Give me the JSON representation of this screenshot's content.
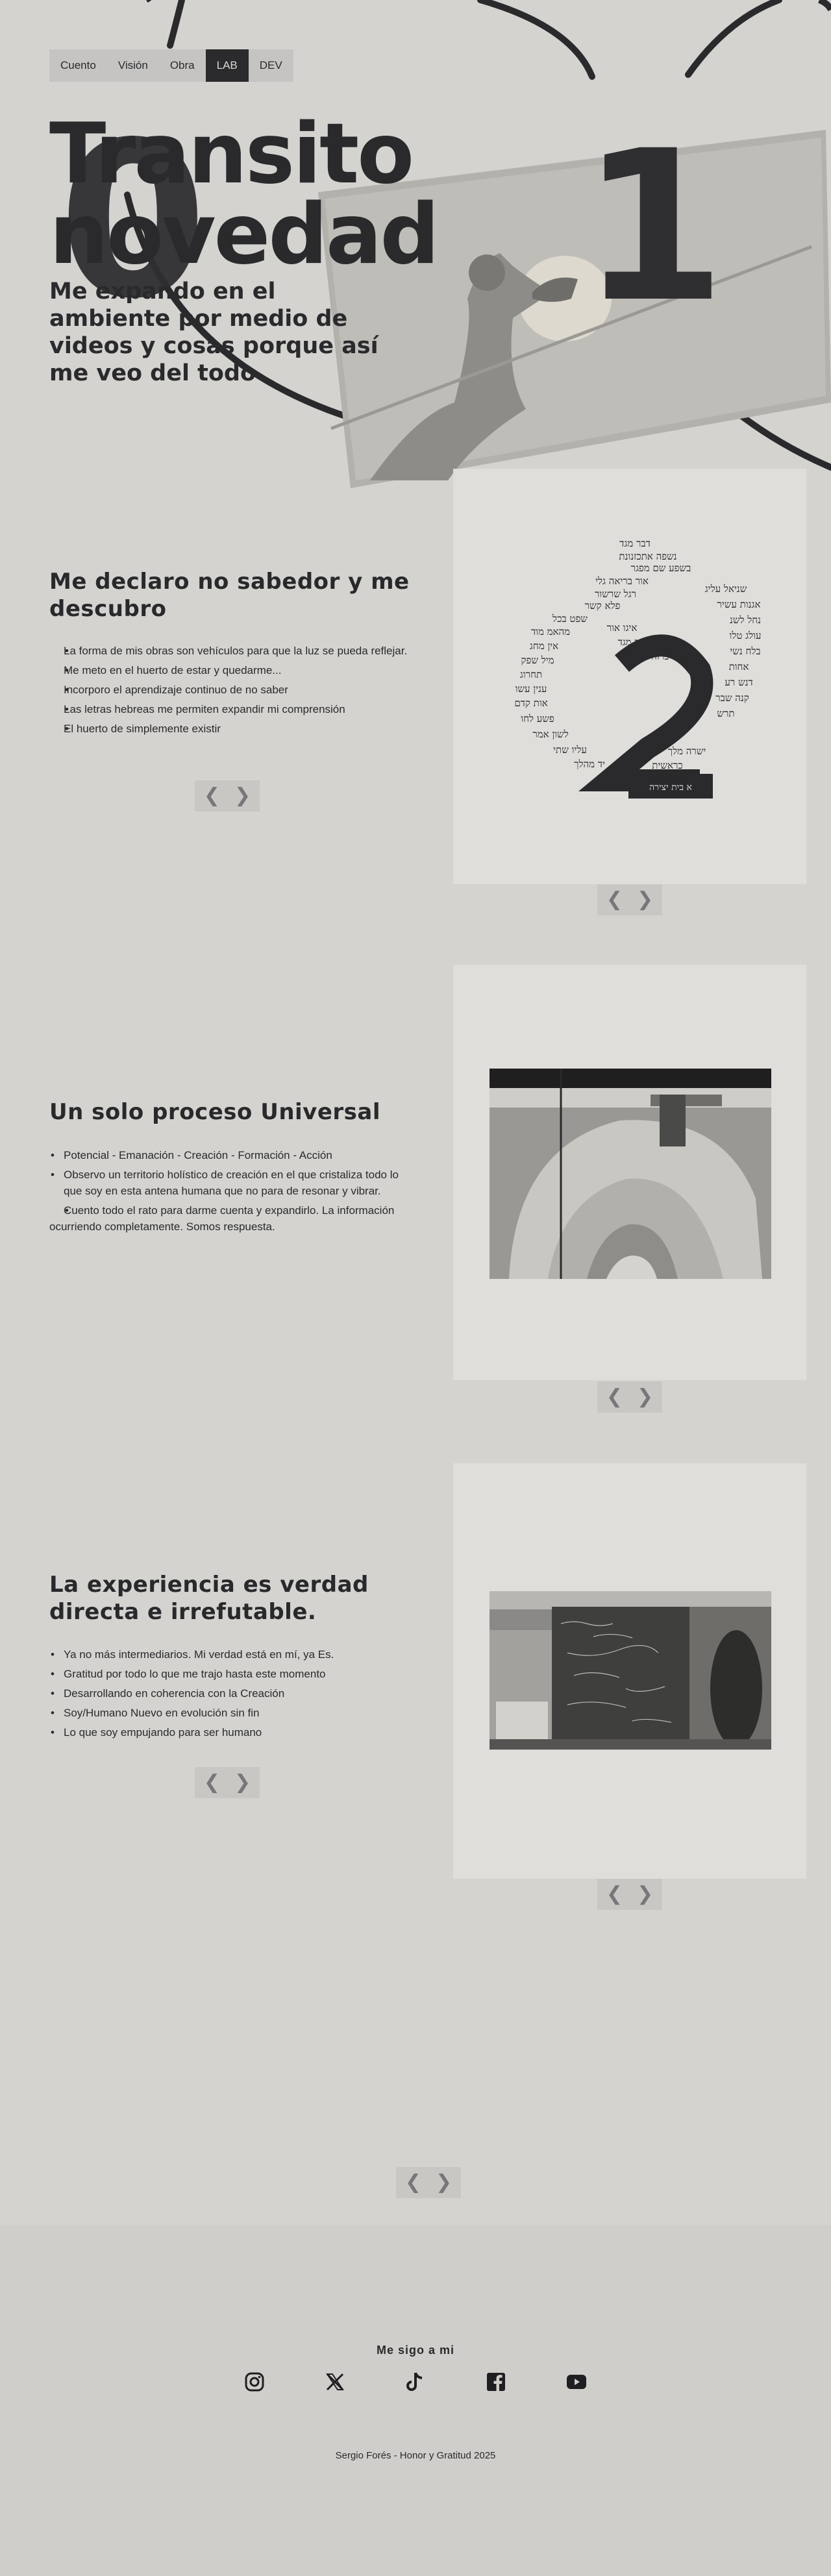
{
  "nav": {
    "items": [
      {
        "label": "Cuento"
      },
      {
        "label": "Visión"
      },
      {
        "label": "Obra"
      },
      {
        "label": "LAB",
        "active": true
      },
      {
        "label": "DEV"
      }
    ]
  },
  "hero": {
    "title_line1": "Transito",
    "title_line2": "novedad",
    "subtitle": "Me expando en el ambiente por medio de videos y cosas porque así me veo del todo",
    "numerals": [
      "0",
      "1",
      "2"
    ]
  },
  "sections": [
    {
      "title": "Me declaro no sabedor y me descubro",
      "bullets": [
        "La forma de mis obras son vehículos para que la luz se pueda reflejar.",
        "Me meto en el huerto de estar y quedarme...",
        "Incorporo el aprendizaje continuo de no saber",
        "Las letras hebreas me permiten expandir mi comprensión",
        "El huerto de simplemente existir"
      ],
      "image": "hebrew-letters-circle"
    },
    {
      "title": "Un solo proceso Universal",
      "bullets": [
        "Potencial - Emanación - Creación - Formación - Acción",
        "Observo un territorio holístico de creación en el que cristaliza todo lo que soy en esta antena humana que no para de resonar y vibrar.",
        "Cuento todo el rato para darme cuenta y expandirlo. La información ocurriendo completamente. Somos respuesta."
      ],
      "image": "3d-printer-sculpture"
    },
    {
      "title": "La experiencia es verdad directa e irrefutable.",
      "bullets": [
        "Ya no más intermediarios. Mi verdad está en mí, ya Es.",
        "Gratitud por todo lo que me trajo hasta este momento",
        "Desarrollando en coherencia con la Creación",
        "Soy/Humano Nuevo en evolución sin fin",
        "Lo que soy empujando para ser humano"
      ],
      "image": "studio-blackboard"
    }
  ],
  "pager": {
    "prev": "❮",
    "next": "❯"
  },
  "footer": {
    "follow": "Me sigo a mi",
    "socials": [
      "instagram-icon",
      "x-icon",
      "tiktok-icon",
      "facebook-icon",
      "youtube-icon"
    ],
    "copyright": "Sergio Forés - Honor y Gratitud 2025"
  },
  "colors": {
    "background": "#d4d3d0",
    "dark": "#2a2a2d",
    "card": "#dfdedb",
    "pager": "#c8c7c4"
  }
}
